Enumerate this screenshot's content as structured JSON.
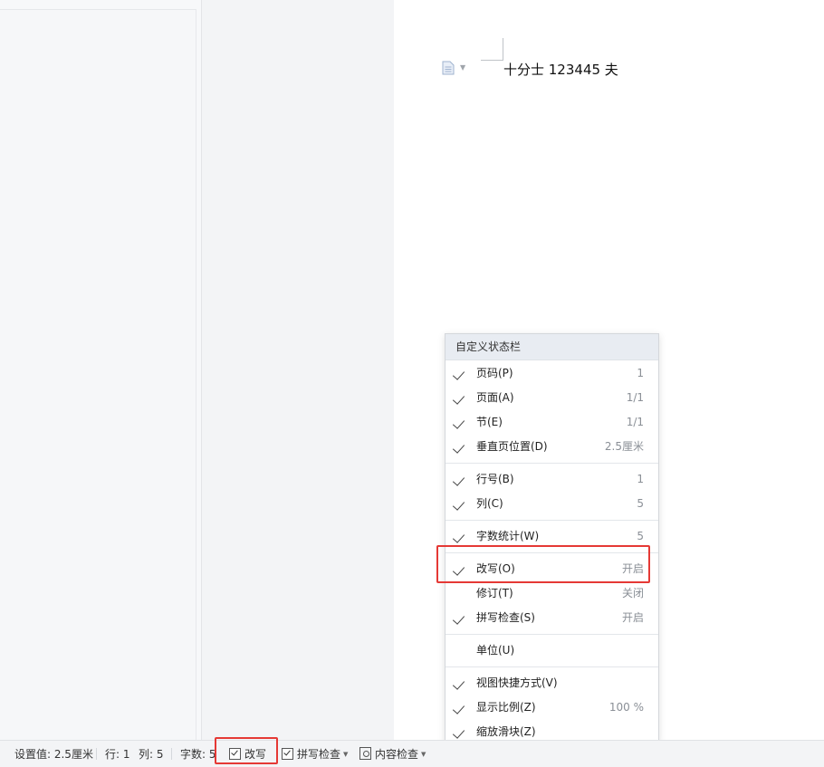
{
  "document": {
    "text": "十分士 123445 夫"
  },
  "status_bar": {
    "setting_value": "设置值: 2.5厘米",
    "row": "行: 1",
    "column": "列: 5",
    "word_count": "字数: 5",
    "overtype": "改写",
    "spell_check": "拼写检查",
    "content_check": "内容检查"
  },
  "menu": {
    "title": "自定义状态栏",
    "groups": [
      [
        {
          "label": "页码(P)",
          "value": "1",
          "checked": true
        },
        {
          "label": "页面(A)",
          "value": "1/1",
          "checked": true
        },
        {
          "label": "节(E)",
          "value": "1/1",
          "checked": true
        },
        {
          "label": "垂直页位置(D)",
          "value": "2.5厘米",
          "checked": true
        }
      ],
      [
        {
          "label": "行号(B)",
          "value": "1",
          "checked": true
        },
        {
          "label": "列(C)",
          "value": "5",
          "checked": true
        }
      ],
      [
        {
          "label": "字数统计(W)",
          "value": "5",
          "checked": true
        }
      ],
      [
        {
          "label": "改写(O)",
          "value": "开启",
          "checked": true
        },
        {
          "label": "修订(T)",
          "value": "关闭",
          "checked": false
        },
        {
          "label": "拼写检查(S)",
          "value": "开启",
          "checked": true
        }
      ],
      [
        {
          "label": "单位(U)",
          "value": "",
          "checked": false
        }
      ],
      [
        {
          "label": "视图快捷方式(V)",
          "value": "",
          "checked": true
        },
        {
          "label": "显示比例(Z)",
          "value": "100 %",
          "checked": true
        },
        {
          "label": "缩放滑块(Z)",
          "value": "",
          "checked": true
        }
      ]
    ]
  },
  "colors": {
    "highlight": "#e53935",
    "menu_header_bg": "#e8ecf2"
  }
}
